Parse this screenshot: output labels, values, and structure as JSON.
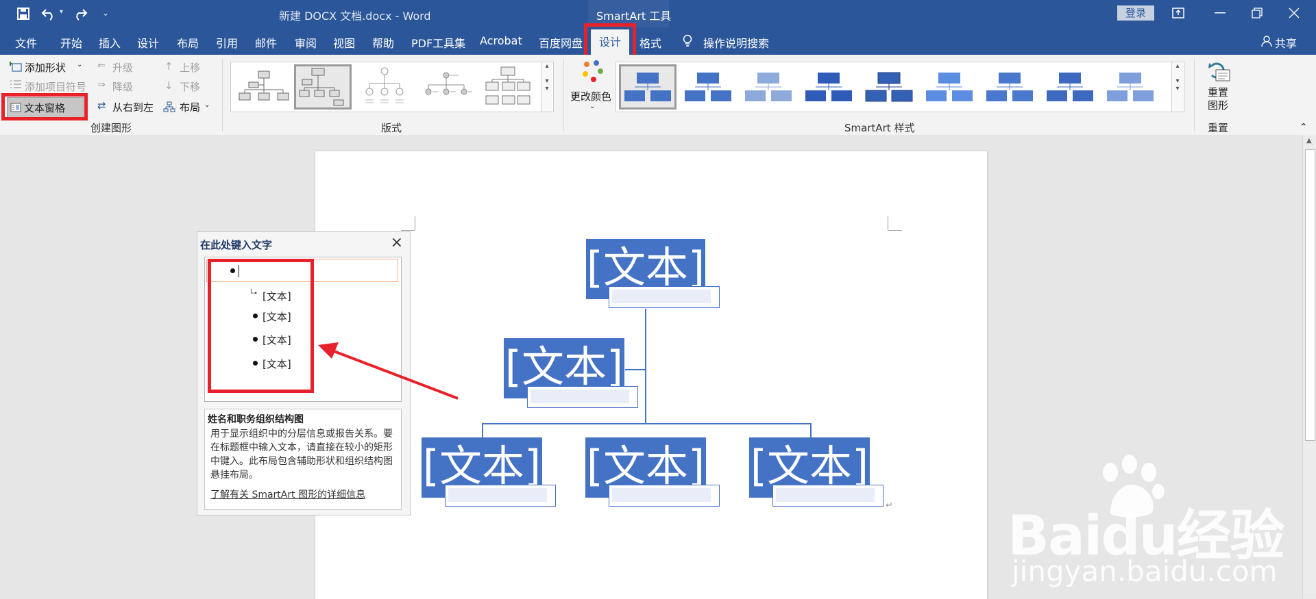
{
  "titlebar": {
    "doc_title": "新建 DOCX 文档.docx  -  Word",
    "context_tool": "SmartArt 工具",
    "login": "登录"
  },
  "tabs": [
    "文件",
    "开始",
    "插入",
    "设计",
    "布局",
    "引用",
    "邮件",
    "审阅",
    "视图",
    "帮助",
    "PDF工具集",
    "Acrobat",
    "百度网盘",
    "设计",
    "格式"
  ],
  "active_tab_index": 13,
  "tell_me": "操作说明搜索",
  "share": "共享",
  "ribbon": {
    "create_group": {
      "add_shape": "添加形状",
      "add_bullet": "添加项目符号",
      "text_pane": "文本窗格",
      "promote": "升级",
      "demote": "降级",
      "rtl": "从右到左",
      "move_up": "上移",
      "move_down": "下移",
      "layout": "布局",
      "label": "创建图形"
    },
    "layouts_label": "版式",
    "change_colors": "更改颜色",
    "styles_label": "SmartArt 样式",
    "reset_graphic": "重置\n图形",
    "reset_label": "重置"
  },
  "text_pane": {
    "title": "在此处键入文字",
    "items": [
      "[文本]",
      "[文本]",
      "[文本]",
      "[文本]"
    ],
    "desc_title": "姓名和职务组织结构图",
    "desc_body": "用于显示组织中的分层信息或报告关系。要在标题框中输入文本，请直接在较小的矩形中键入。此布局包含辅助形状和组织结构图悬挂布局。",
    "desc_link": "了解有关 SmartArt 图形的详细信息"
  },
  "smartart": {
    "top": "[文本]",
    "assistant": "[文本]",
    "children": [
      "[文本]",
      "[文本]",
      "[文本]"
    ]
  },
  "watermark": {
    "brand": "Baidu经验",
    "url": "jingyan.baidu.com"
  },
  "colors": {
    "word_blue": "#2b579a",
    "node_blue": "#4472c4",
    "highlight_red": "#e8212b"
  }
}
